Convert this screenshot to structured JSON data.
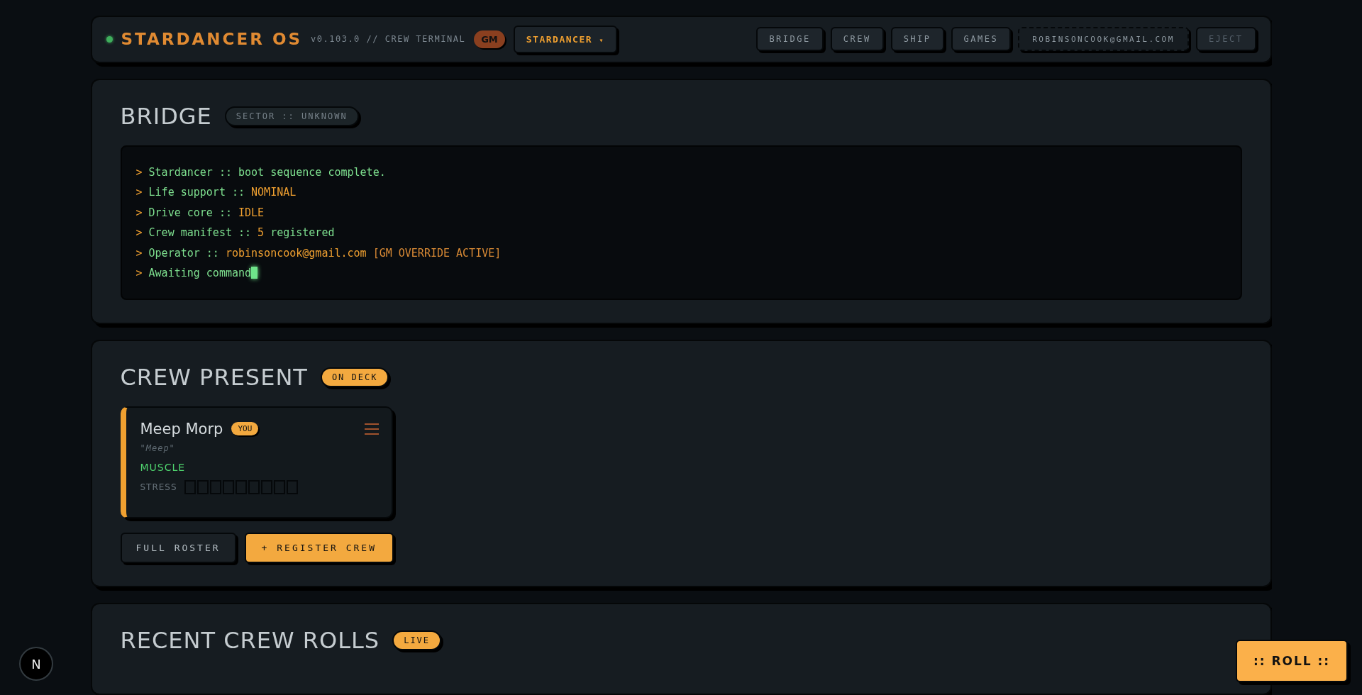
{
  "header": {
    "title": "STARDANCER OS",
    "version": "v0.103.0 // CREW TERMINAL",
    "role_badge": "GM",
    "ship_select": "STARDANCER",
    "ship_caret": "▾",
    "nav": [
      {
        "label": "BRIDGE",
        "kind": "link"
      },
      {
        "label": "CREW",
        "kind": "link"
      },
      {
        "label": "SHIP",
        "kind": "link"
      },
      {
        "label": "GAMES",
        "kind": "link"
      },
      {
        "label": "ROBINSONCOOK@GMAIL.COM",
        "kind": "user"
      },
      {
        "label": "EJECT",
        "kind": "muted"
      }
    ]
  },
  "bridge": {
    "title": "BRIDGE",
    "sector": "SECTOR :: UNKNOWN",
    "terminal": [
      {
        "prompt": ">",
        "parts": [
          {
            "text": "Stardancer :: boot sequence complete.",
            "kind": "plain"
          }
        ]
      },
      {
        "prompt": ">",
        "parts": [
          {
            "text": "Life support :: ",
            "kind": "plain"
          },
          {
            "text": "NOMINAL",
            "kind": "value"
          }
        ]
      },
      {
        "prompt": ">",
        "parts": [
          {
            "text": "Drive core :: ",
            "kind": "plain"
          },
          {
            "text": "IDLE",
            "kind": "value"
          }
        ]
      },
      {
        "prompt": ">",
        "parts": [
          {
            "text": "Crew manifest :: ",
            "kind": "plain"
          },
          {
            "text": "5",
            "kind": "value"
          },
          {
            "text": " registered",
            "kind": "plain"
          }
        ]
      },
      {
        "prompt": ">",
        "parts": [
          {
            "text": "Operator :: ",
            "kind": "plain"
          },
          {
            "text": "robinsoncook@gmail.com",
            "kind": "value"
          },
          {
            "text": " [GM OVERRIDE ACTIVE]",
            "kind": "note"
          }
        ]
      },
      {
        "prompt": ">",
        "parts": [
          {
            "text": "Awaiting command",
            "kind": "plain"
          }
        ],
        "cursor": true
      }
    ]
  },
  "crew": {
    "title": "CREW PRESENT",
    "badge": "ON DECK",
    "members": [
      {
        "name": "Meep Morp",
        "badge": "YOU",
        "alias": "\"Meep\"",
        "playbook": "MUSCLE",
        "stress_label": "STRESS",
        "stress": [
          false,
          false,
          false,
          false,
          false,
          false,
          false,
          false,
          false
        ]
      }
    ],
    "buttons": [
      {
        "label": "FULL ROSTER",
        "kind": "secondary"
      },
      {
        "label": "+ REGISTER CREW",
        "kind": "primary"
      }
    ]
  },
  "rolls": {
    "title": "RECENT CREW ROLLS",
    "badge": "LIVE"
  },
  "roll_button": ":: ROLL ::",
  "dev_badge": "N"
}
